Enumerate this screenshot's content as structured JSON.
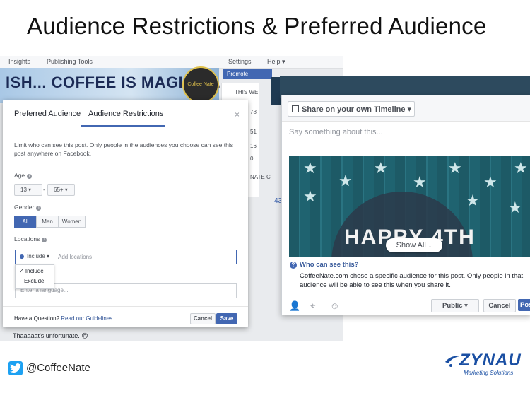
{
  "slide": {
    "title": "Audience Restrictions & Preferred Audience",
    "twitter_handle": "@CoffeeNate",
    "brand_name": "ZYNAU",
    "brand_tagline": "Marketing Solutions"
  },
  "fb_page": {
    "nav": [
      "Insights",
      "Publishing Tools",
      "Settings",
      "Help ▾"
    ],
    "cover_text": "ISH... COFFEE IS MAGICAL.",
    "logo_text": "Coffee Nate",
    "promote_label": "Promote",
    "side_texts": [
      "THIS WE",
      "78",
      "51",
      "16",
      "0",
      "NATE C",
      "43"
    ],
    "comment_text": "Thaaaaat's unfortunate. 😢"
  },
  "modal": {
    "tabs": [
      "Preferred Audience",
      "Audience Restrictions"
    ],
    "active_tab": "Audience Restrictions",
    "close_label": "×",
    "description_line1": "Limit who can see this post. Only people in the audiences you choose can see this",
    "description_line2": "post anywhere on Facebook.",
    "age_label": "Age",
    "age_min": "13 ▾",
    "age_sep": "-",
    "age_max": "65+ ▾",
    "gender_label": "Gender",
    "gender_options": [
      "All",
      "Men",
      "Women"
    ],
    "gender_selected": "All",
    "locations_label": "Locations",
    "location_mode": "Include ▾",
    "location_placeholder": "Add locations",
    "location_menu": [
      "✓ Include",
      "Exclude"
    ],
    "language_placeholder": "Enter a language...",
    "question_text": "Have a Question?",
    "question_link": "Read our Guidelines.",
    "cancel_label": "Cancel",
    "save_label": "Save"
  },
  "share": {
    "target_label": "Share on your own Timeline ▾",
    "say_placeholder": "Say something about this...",
    "banner_text": "HAPPY 4TH",
    "show_all_label": "Show All ↓",
    "who_title": "Who can see this?",
    "who_line1": "CoffeeNate.com chose a specific audience for this post. Only people in that",
    "who_line2": "audience will be able to see this when you share it.",
    "public_label": "Public ▾",
    "cancel_label": "Cancel",
    "post_label": "Post"
  },
  "colors": {
    "facebook_blue": "#4267b2",
    "link_blue": "#365899",
    "twitter_blue": "#1da1f2",
    "brand_blue": "#1a4fa3"
  }
}
